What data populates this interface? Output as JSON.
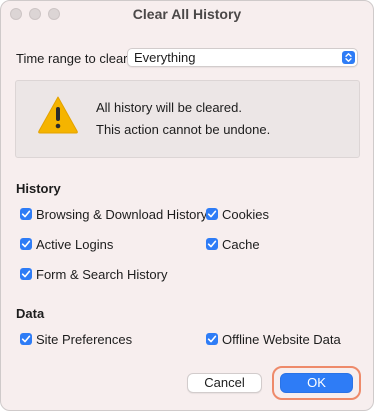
{
  "window": {
    "title": "Clear All History"
  },
  "time_range": {
    "label": "Time range to clear:",
    "selected": "Everything"
  },
  "warning": {
    "icon": "warning-triangle-icon",
    "line1": "All history will be cleared.",
    "line2": "This action cannot be undone."
  },
  "history": {
    "heading": "History",
    "items": [
      {
        "label": "Browsing & Download History",
        "checked": true
      },
      {
        "label": "Cookies",
        "checked": true
      },
      {
        "label": "Active Logins",
        "checked": true
      },
      {
        "label": "Cache",
        "checked": true
      },
      {
        "label": "Form & Search History",
        "checked": true
      }
    ]
  },
  "data_section": {
    "heading": "Data",
    "items": [
      {
        "label": "Site Preferences",
        "checked": true
      },
      {
        "label": "Offline Website Data",
        "checked": true
      }
    ]
  },
  "buttons": {
    "cancel": "Cancel",
    "ok": "OK"
  },
  "colors": {
    "accent": "#2e7cf6",
    "focus_ring": "#ee8a6a",
    "window_bg": "#f7eeee",
    "warning": "#f5b400"
  }
}
